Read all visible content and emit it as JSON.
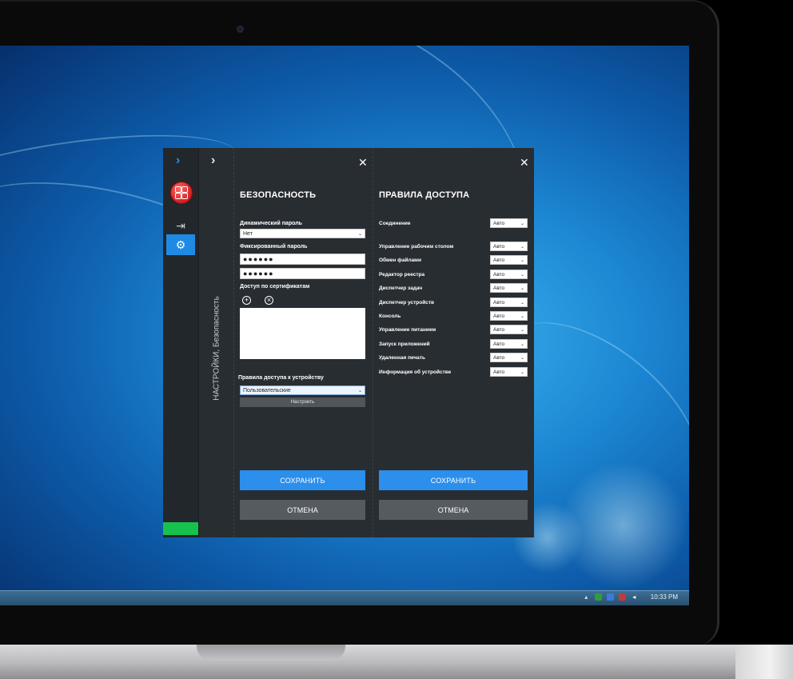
{
  "app": {
    "breadcrumb": "НАСТРОЙКИ, Безопасность"
  },
  "security": {
    "title": "БЕЗОПАСНОСТЬ",
    "dynamic_password_label": "Динамический пароль",
    "dynamic_password_value": "Нет",
    "fixed_password_label": "Фиксированный пароль",
    "password_value": "●●●●●●",
    "password_confirm_value": "●●●●●●",
    "cert_access_label": "Доступ по сертификатам",
    "device_rules_label": "Правила доступа к устройству",
    "device_rules_value": "Пользовательские",
    "configure_label": "Настроить",
    "save_label": "СОХРАНИТЬ",
    "cancel_label": "ОТМЕНА"
  },
  "access": {
    "title": "ПРАВИЛА ДОСТУПА",
    "save_label": "СОХРАНИТЬ",
    "cancel_label": "ОТМЕНА",
    "rules": [
      {
        "name": "Соединение",
        "value": "Авто"
      },
      {
        "name": "Управление рабочим столом",
        "value": "Авто"
      },
      {
        "name": "Обмен файлами",
        "value": "Авто"
      },
      {
        "name": "Редактор реестра",
        "value": "Авто"
      },
      {
        "name": "Диспетчер задач",
        "value": "Авто"
      },
      {
        "name": "Диспетчер устройств",
        "value": "Авто"
      },
      {
        "name": "Консоль",
        "value": "Авто"
      },
      {
        "name": "Управление питанием",
        "value": "Авто"
      },
      {
        "name": "Запуск приложений",
        "value": "Авто"
      },
      {
        "name": "Удаленная печать",
        "value": "Авто"
      },
      {
        "name": "Информация об устройстве",
        "value": "Авто"
      }
    ]
  },
  "taskbar": {
    "clock": "10:33 PM"
  },
  "colors": {
    "accent": "#2c8fec",
    "panel_bg": "#282d32",
    "status_green": "#17c14e"
  }
}
